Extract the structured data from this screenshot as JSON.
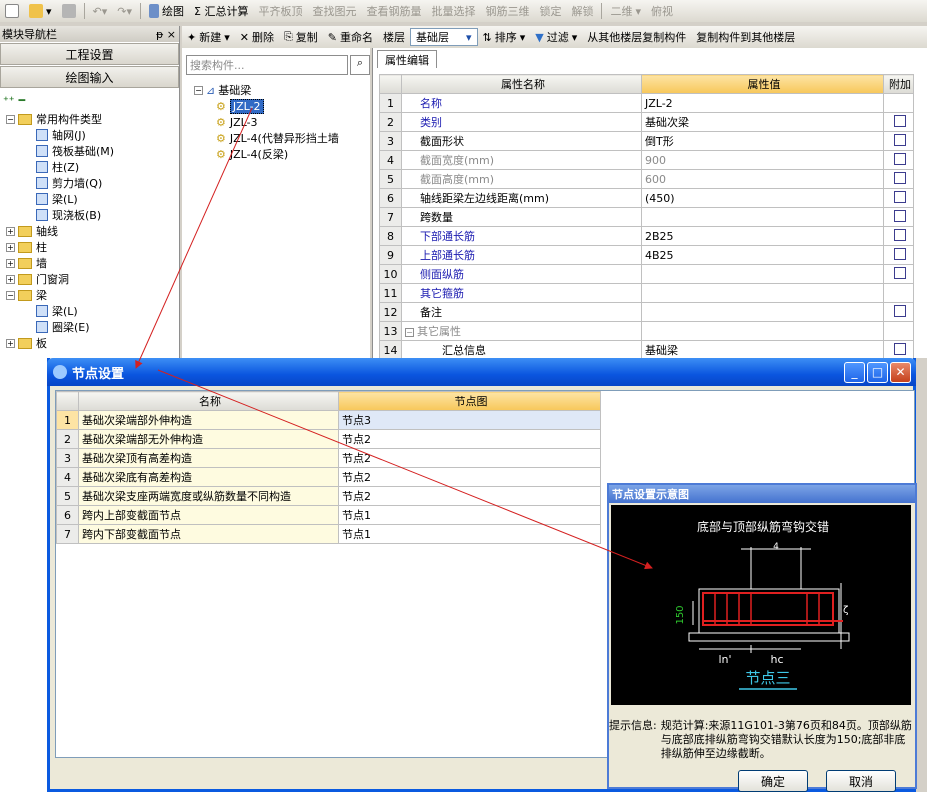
{
  "toolbar": {
    "items": [
      "绘图",
      "Σ 汇总计算",
      "平齐板顶",
      "查找图元",
      "查看钢筋量",
      "批量选择",
      "钢筋三维",
      "锁定",
      "解锁",
      "二维",
      "俯视"
    ]
  },
  "nav": {
    "title": "模块导航栏",
    "pin": "ᵽ ×",
    "tab_project": "工程设置",
    "tab_draw": "绘图输入",
    "tree": [
      {
        "label": "常用构件类型",
        "level": 0,
        "kind": "folder",
        "open": true
      },
      {
        "label": "轴网(J)",
        "level": 1,
        "kind": "item"
      },
      {
        "label": "筏板基础(M)",
        "level": 1,
        "kind": "item"
      },
      {
        "label": "柱(Z)",
        "level": 1,
        "kind": "item"
      },
      {
        "label": "剪力墙(Q)",
        "level": 1,
        "kind": "item"
      },
      {
        "label": "梁(L)",
        "level": 1,
        "kind": "item"
      },
      {
        "label": "现浇板(B)",
        "level": 1,
        "kind": "item"
      },
      {
        "label": "轴线",
        "level": 0,
        "kind": "folder",
        "open": false
      },
      {
        "label": "柱",
        "level": 0,
        "kind": "folder",
        "open": false
      },
      {
        "label": "墙",
        "level": 0,
        "kind": "folder",
        "open": false
      },
      {
        "label": "门窗洞",
        "level": 0,
        "kind": "folder",
        "open": false
      },
      {
        "label": "梁",
        "level": 0,
        "kind": "folder",
        "open": true
      },
      {
        "label": "梁(L)",
        "level": 1,
        "kind": "item"
      },
      {
        "label": "圈梁(E)",
        "level": 1,
        "kind": "item"
      },
      {
        "label": "板",
        "level": 0,
        "kind": "folder",
        "open": false
      }
    ]
  },
  "comp_toolbar": {
    "items": [
      "新建",
      "删除",
      "复制",
      "重命名",
      "楼层",
      "基础层",
      "排序",
      "过滤",
      "从其他楼层复制构件",
      "复制构件到其他楼层"
    ]
  },
  "components": {
    "search_placeholder": "搜索构件...",
    "root": "基础梁",
    "items": [
      "JZL-2",
      "JZL-3",
      "JZL-4(代替异形挡土墙",
      "JZL-4(反梁)"
    ]
  },
  "property": {
    "tab": "属性编辑",
    "headers": [
      "属性名称",
      "属性值",
      "附加"
    ],
    "rows": [
      {
        "n": "1",
        "name": "名称",
        "value": "JZL-2",
        "style": "blue",
        "chk": false
      },
      {
        "n": "2",
        "name": "类别",
        "value": "基础次梁",
        "style": "blue",
        "chk": true
      },
      {
        "n": "3",
        "name": "截面形状",
        "value": "倒T形",
        "style": "normal",
        "chk": true
      },
      {
        "n": "4",
        "name": "截面宽度(mm)",
        "value": "900",
        "style": "gray",
        "chk": true
      },
      {
        "n": "5",
        "name": "截面高度(mm)",
        "value": "600",
        "style": "gray",
        "chk": true
      },
      {
        "n": "6",
        "name": "轴线距梁左边线距离(mm)",
        "value": "(450)",
        "style": "normal",
        "chk": true
      },
      {
        "n": "7",
        "name": "跨数量",
        "value": "",
        "style": "normal",
        "chk": true
      },
      {
        "n": "8",
        "name": "下部通长筋",
        "value": "2B25",
        "style": "blue",
        "chk": true
      },
      {
        "n": "9",
        "name": "上部通长筋",
        "value": "4B25",
        "style": "blue",
        "chk": true
      },
      {
        "n": "10",
        "name": "侧面纵筋",
        "value": "",
        "style": "blue",
        "chk": true
      },
      {
        "n": "11",
        "name": "其它箍筋",
        "value": "",
        "style": "blue",
        "chk": false
      },
      {
        "n": "12",
        "name": "备注",
        "value": "",
        "style": "normal",
        "chk": true
      },
      {
        "n": "13",
        "name": "其它属性",
        "value": "",
        "style": "gray",
        "chk": false
      },
      {
        "n": "14",
        "name": "汇总信息",
        "value": "基础梁",
        "style": "normal",
        "chk": true
      }
    ]
  },
  "dialog": {
    "title": "节点设置",
    "headers": [
      "名称",
      "节点图"
    ],
    "rows": [
      {
        "n": "1",
        "name": "基础次梁端部外伸构造",
        "value": "节点3"
      },
      {
        "n": "2",
        "name": "基础次梁端部无外伸构造",
        "value": "节点2"
      },
      {
        "n": "3",
        "name": "基础次梁顶有高差构造",
        "value": "节点2"
      },
      {
        "n": "4",
        "name": "基础次梁底有高差构造",
        "value": "节点2"
      },
      {
        "n": "5",
        "name": "基础次梁支座两端宽度或纵筋数量不同构造",
        "value": "节点2"
      },
      {
        "n": "6",
        "name": "跨内上部变截面节点",
        "value": "节点1"
      },
      {
        "n": "7",
        "name": "跨内下部变截面节点",
        "value": "节点1"
      }
    ],
    "schematic_title": "节点设置示意图",
    "diagram": {
      "caption": "底部与顶部纵筋弯钩交错",
      "dim_150": "150",
      "dim_ln": "ln'",
      "dim_hc": "hc",
      "node_name": "节点三",
      "dim_4": "4"
    },
    "hint_label": "提示信息:",
    "hint_text": "规范计算:来源11G101-3第76页和84页。顶部纵筋与底部底排纵筋弯钩交错默认长度为150;底部非底排纵筋伸至边缘截断。",
    "ok": "确定",
    "cancel": "取消"
  },
  "colors": {
    "title_blue": "#0a55df",
    "header_orange": "#f7c75a",
    "rebar_red": "#e02020",
    "arrow_red": "#d42020",
    "node_cyan": "#3fc8e8"
  }
}
